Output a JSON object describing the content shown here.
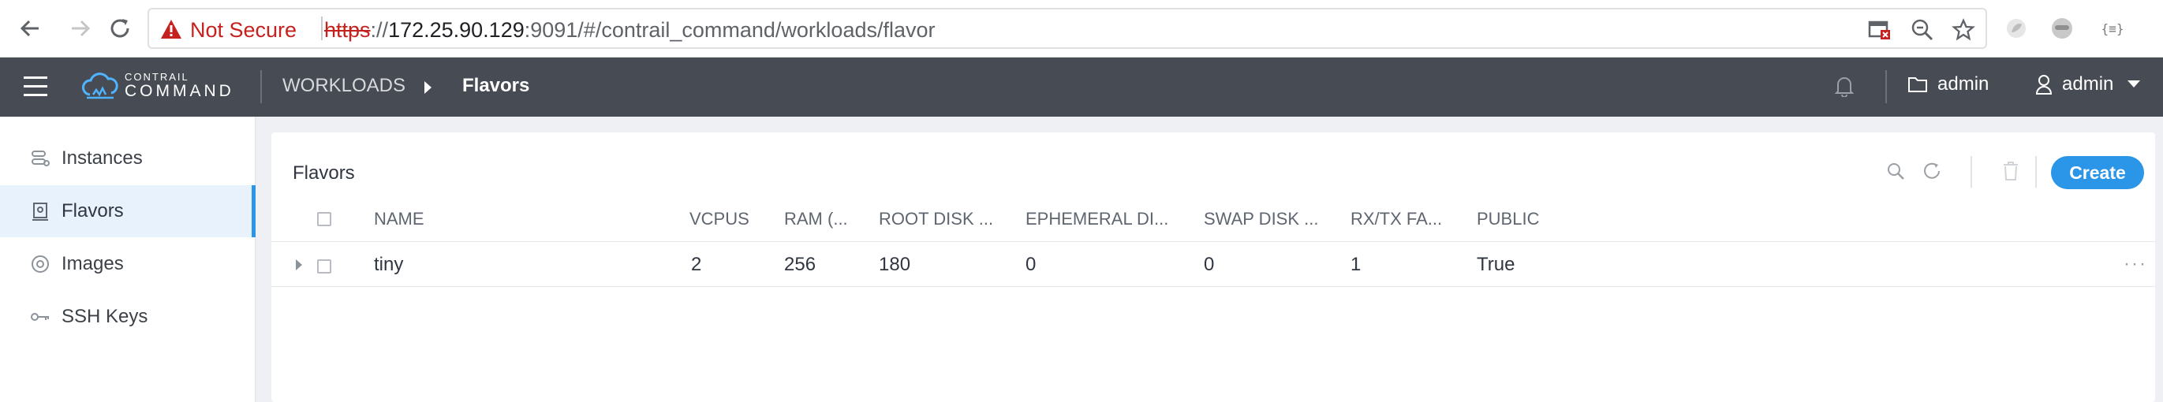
{
  "browser": {
    "security_label": "Not Secure",
    "url_scheme": "https",
    "url_sep": "://",
    "url_host": "172.25.90.129",
    "url_rest": ":9091/#/contrail_command/workloads/flavor",
    "ext_json_label": "{≡}"
  },
  "header": {
    "logo_top": "CONTRAIL",
    "logo_bottom": "COMMAND",
    "breadcrumb_parent": "WORKLOADS",
    "breadcrumb_current": "Flavors",
    "project_label": "admin",
    "user_label": "admin"
  },
  "sidebar": {
    "items": [
      {
        "label": "Instances",
        "icon": "instances-icon"
      },
      {
        "label": "Flavors",
        "icon": "flavors-icon",
        "active": true
      },
      {
        "label": "Images",
        "icon": "images-icon"
      },
      {
        "label": "SSH Keys",
        "icon": "key-icon"
      }
    ]
  },
  "main": {
    "title": "Flavors",
    "create_label": "Create",
    "columns": [
      "NAME",
      "VCPUS",
      "RAM (...",
      "ROOT DISK ...",
      "EPHEMERAL DI...",
      "SWAP DISK ...",
      "RX/TX FA...",
      "PUBLIC"
    ],
    "rows": [
      {
        "name": "tiny",
        "vcpus": "2",
        "ram": "256",
        "root_disk": "180",
        "ephemeral": "0",
        "swap": "0",
        "rxtx": "1",
        "public": "True",
        "menu": "···"
      }
    ]
  },
  "colors": {
    "header_bg": "#474c54",
    "accent": "#2b95e8",
    "insecure": "#c5221f"
  }
}
